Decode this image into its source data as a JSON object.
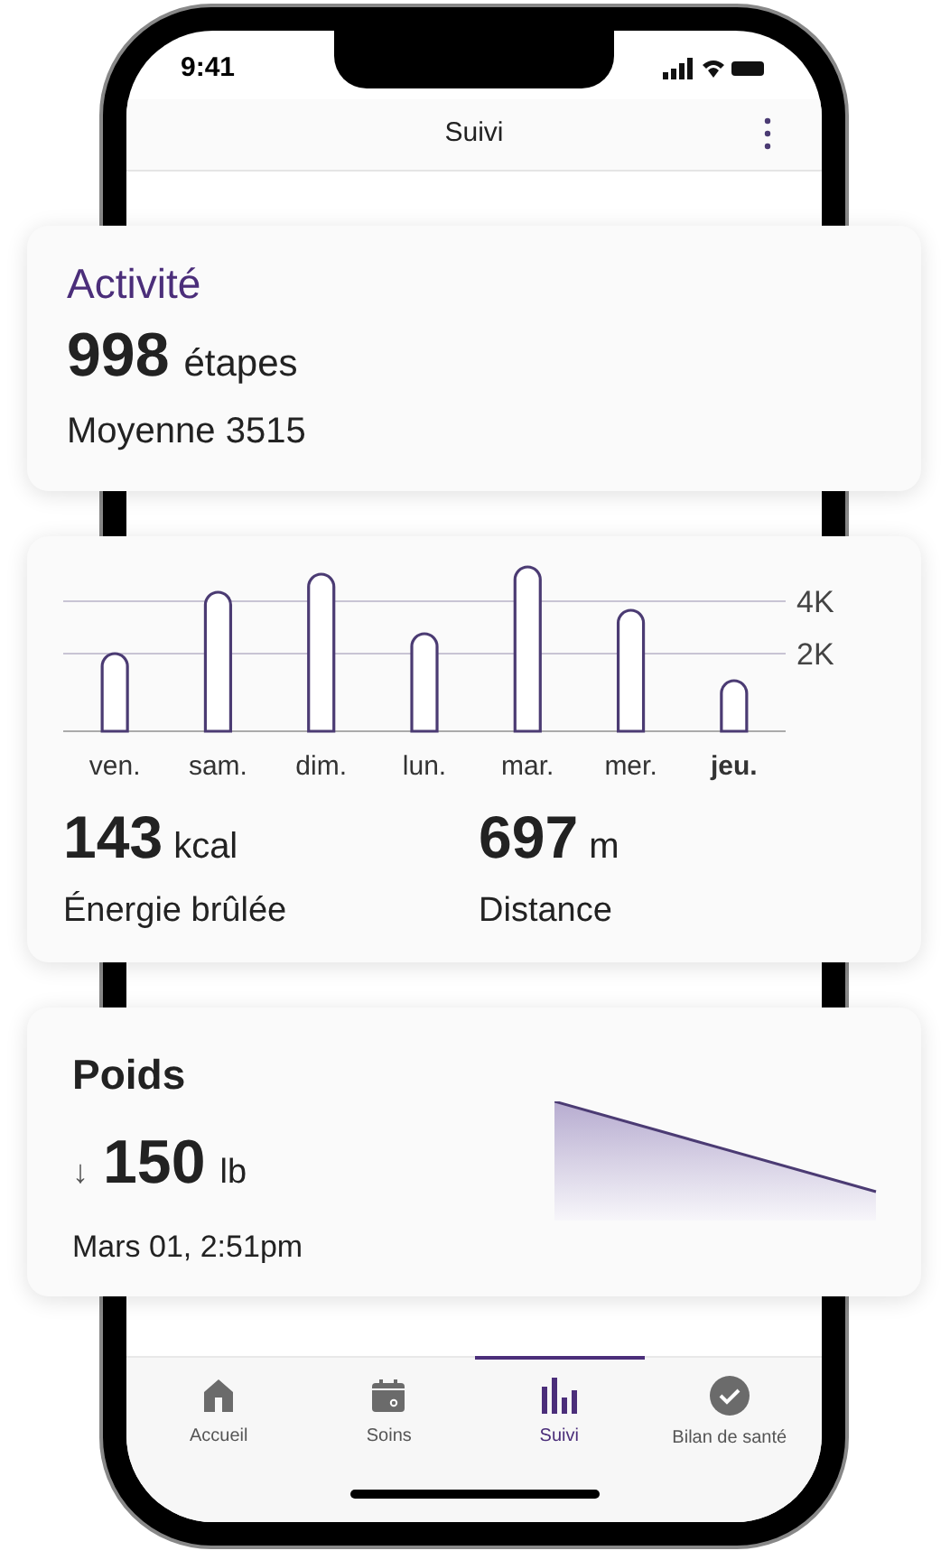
{
  "status_bar": {
    "time": "9:41"
  },
  "header": {
    "title": "Suivi"
  },
  "activity": {
    "title": "Activité",
    "steps": "998",
    "steps_unit": "étapes",
    "average": "Moyenne 3515"
  },
  "chart_card": {
    "y_labels": [
      "4K",
      "2K"
    ],
    "days": [
      {
        "label": "ven.",
        "today": false
      },
      {
        "label": "sam.",
        "today": false
      },
      {
        "label": "dim.",
        "today": false
      },
      {
        "label": "lun.",
        "today": false
      },
      {
        "label": "mar.",
        "today": false
      },
      {
        "label": "mer.",
        "today": false
      },
      {
        "label": "jeu.",
        "today": true
      }
    ],
    "stats": [
      {
        "value": "143",
        "unit": "kcal",
        "label": "Énergie brûlée"
      },
      {
        "value": "697",
        "unit": "m",
        "label": "Distance"
      }
    ]
  },
  "weight": {
    "title": "Poids",
    "trend": "↓",
    "value": "150",
    "unit": "lb",
    "date": "Mars 01, 2:51pm"
  },
  "tabs": [
    {
      "label": "Accueil",
      "kind": "home",
      "selected": false
    },
    {
      "label": "Soins",
      "kind": "calendar",
      "selected": false
    },
    {
      "label": "Suivi",
      "kind": "chart",
      "selected": true
    },
    {
      "label": "Bilan de santé",
      "kind": "check",
      "selected": false
    }
  ]
}
